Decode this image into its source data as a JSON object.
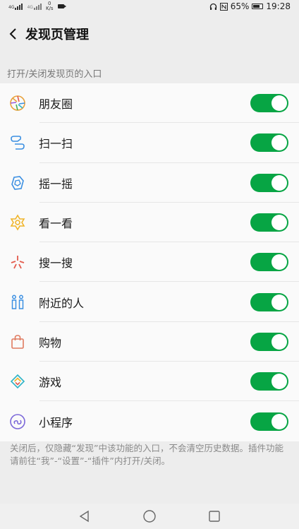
{
  "status_bar": {
    "network_speed": "K/s",
    "battery_percent": "65%",
    "time": "19:28",
    "signal_1": "4G",
    "signal_2": "4G",
    "icons": [
      "signal-icon",
      "signal-icon",
      "network-speed-icon",
      "video-icon",
      "headset-icon",
      "nfc-icon",
      "battery-icon"
    ]
  },
  "header": {
    "title": "发现页管理",
    "back_icon": "chevron-left-icon"
  },
  "section": {
    "label": "打开/关闭发现页的入口"
  },
  "items": [
    {
      "label": "朋友圈",
      "icon": "moments-icon",
      "enabled": true
    },
    {
      "label": "扫一扫",
      "icon": "scan-icon",
      "enabled": true
    },
    {
      "label": "摇一摇",
      "icon": "shake-icon",
      "enabled": true
    },
    {
      "label": "看一看",
      "icon": "top-stories-icon",
      "enabled": true
    },
    {
      "label": "搜一搜",
      "icon": "search-icon",
      "enabled": true
    },
    {
      "label": "附近的人",
      "icon": "people-nearby-icon",
      "enabled": true
    },
    {
      "label": "购物",
      "icon": "shopping-bag-icon",
      "enabled": true
    },
    {
      "label": "游戏",
      "icon": "games-icon",
      "enabled": true
    },
    {
      "label": "小程序",
      "icon": "mini-program-icon",
      "enabled": true
    }
  ],
  "footnote": "关闭后，仅隐藏“发现”中该功能的入口，不会清空历史数据。插件功能请前往“我”-“设置”-“插件”内打开/关闭。",
  "colors": {
    "toggle_on": "#07a544",
    "background": "#ededed",
    "list_background": "#fafafa"
  },
  "android_nav": {
    "icons": [
      "back-triangle-icon",
      "home-circle-icon",
      "recents-square-icon"
    ]
  }
}
